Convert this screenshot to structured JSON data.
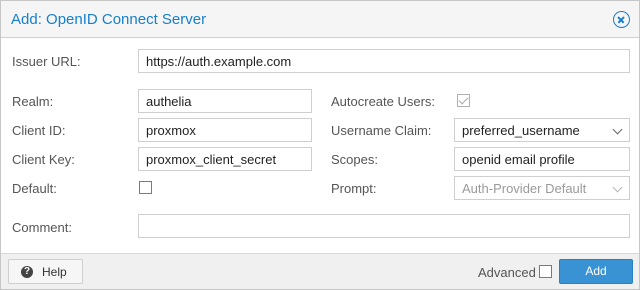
{
  "window": {
    "title": "Add: OpenID Connect Server",
    "close_icon": "close-circle-icon",
    "accent_color": "#157fcc"
  },
  "form": {
    "issuer_url": {
      "label": "Issuer URL:",
      "value": "https://auth.example.com"
    },
    "realm": {
      "label": "Realm:",
      "value": "authelia"
    },
    "client_id": {
      "label": "Client ID:",
      "value": "proxmox"
    },
    "client_key": {
      "label": "Client Key:",
      "value": "proxmox_client_secret"
    },
    "default": {
      "label": "Default:",
      "checked": false
    },
    "autocreate_users": {
      "label": "Autocreate Users:",
      "checked": true,
      "disabled": true
    },
    "username_claim": {
      "label": "Username Claim:",
      "value": "preferred_username"
    },
    "scopes": {
      "label": "Scopes:",
      "value": "openid email profile"
    },
    "prompt": {
      "label": "Prompt:",
      "value": "Auth-Provider Default",
      "disabled": true
    },
    "comment": {
      "label": "Comment:",
      "value": ""
    }
  },
  "footer": {
    "help_label": "Help",
    "help_icon": "question-circle-icon",
    "advanced_label": "Advanced",
    "advanced_checked": false,
    "add_label": "Add",
    "add_color": "#3892d4"
  }
}
